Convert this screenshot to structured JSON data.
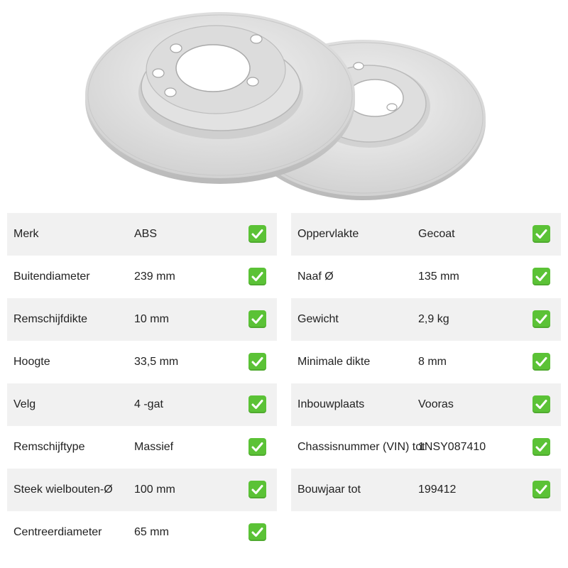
{
  "image": {
    "subject": "brake-disc-pair",
    "icon": "brake-disc-icon"
  },
  "status_icon": "check-icon",
  "accent_color": "#5bc236",
  "specs_left": [
    {
      "label": "Merk",
      "value": "ABS"
    },
    {
      "label": "Buitendiameter",
      "value": "239 mm"
    },
    {
      "label": "Remschijfdikte",
      "value": "10 mm"
    },
    {
      "label": "Hoogte",
      "value": "33,5 mm"
    },
    {
      "label": "Velg",
      "value": "4 -gat"
    },
    {
      "label": "Remschijftype",
      "value": "Massief"
    },
    {
      "label": "Steek wielbouten-Ø",
      "value": "100 mm"
    },
    {
      "label": "Centreerdiameter",
      "value": "65 mm"
    }
  ],
  "specs_right": [
    {
      "label": "Oppervlakte",
      "value": "Gecoat"
    },
    {
      "label": "Naaf Ø",
      "value": "135 mm"
    },
    {
      "label": "Gewicht",
      "value": "2,9 kg"
    },
    {
      "label": "Minimale dikte",
      "value": "8 mm"
    },
    {
      "label": "Inbouwplaats",
      "value": "Vooras"
    },
    {
      "label": "Chassisnummer (VIN) tot",
      "value": "1NSY087410"
    },
    {
      "label": "Bouwjaar tot",
      "value": "199412"
    }
  ]
}
